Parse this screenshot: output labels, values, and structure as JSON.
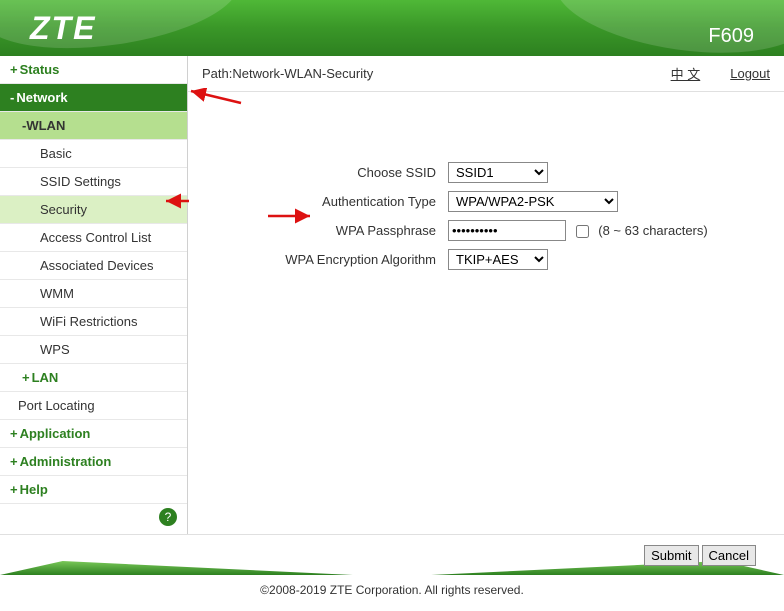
{
  "header": {
    "brand": "ZTE",
    "model": "F609"
  },
  "path": {
    "label": "Path:Network-WLAN-Security",
    "lang": "中 文",
    "logout": "Logout"
  },
  "sidebar": {
    "status": "Status",
    "network": "Network",
    "wlan": "WLAN",
    "items": {
      "basic": "Basic",
      "ssid": "SSID Settings",
      "security": "Security",
      "acl": "Access Control List",
      "assoc": "Associated Devices",
      "wmm": "WMM",
      "wifir": "WiFi Restrictions",
      "wps": "WPS"
    },
    "lan": "LAN",
    "port": "Port Locating",
    "application": "Application",
    "admin": "Administration",
    "help": "Help"
  },
  "form": {
    "ssid_label": "Choose SSID",
    "ssid_value": "SSID1",
    "auth_label": "Authentication Type",
    "auth_value": "WPA/WPA2-PSK",
    "pass_label": "WPA Passphrase",
    "pass_value": "••••••••••",
    "pass_hint": "(8 ~ 63 characters)",
    "enc_label": "WPA Encryption Algorithm",
    "enc_value": "TKIP+AES"
  },
  "buttons": {
    "submit": "Submit",
    "cancel": "Cancel"
  },
  "footer": "©2008-2019 ZTE Corporation. All rights reserved."
}
